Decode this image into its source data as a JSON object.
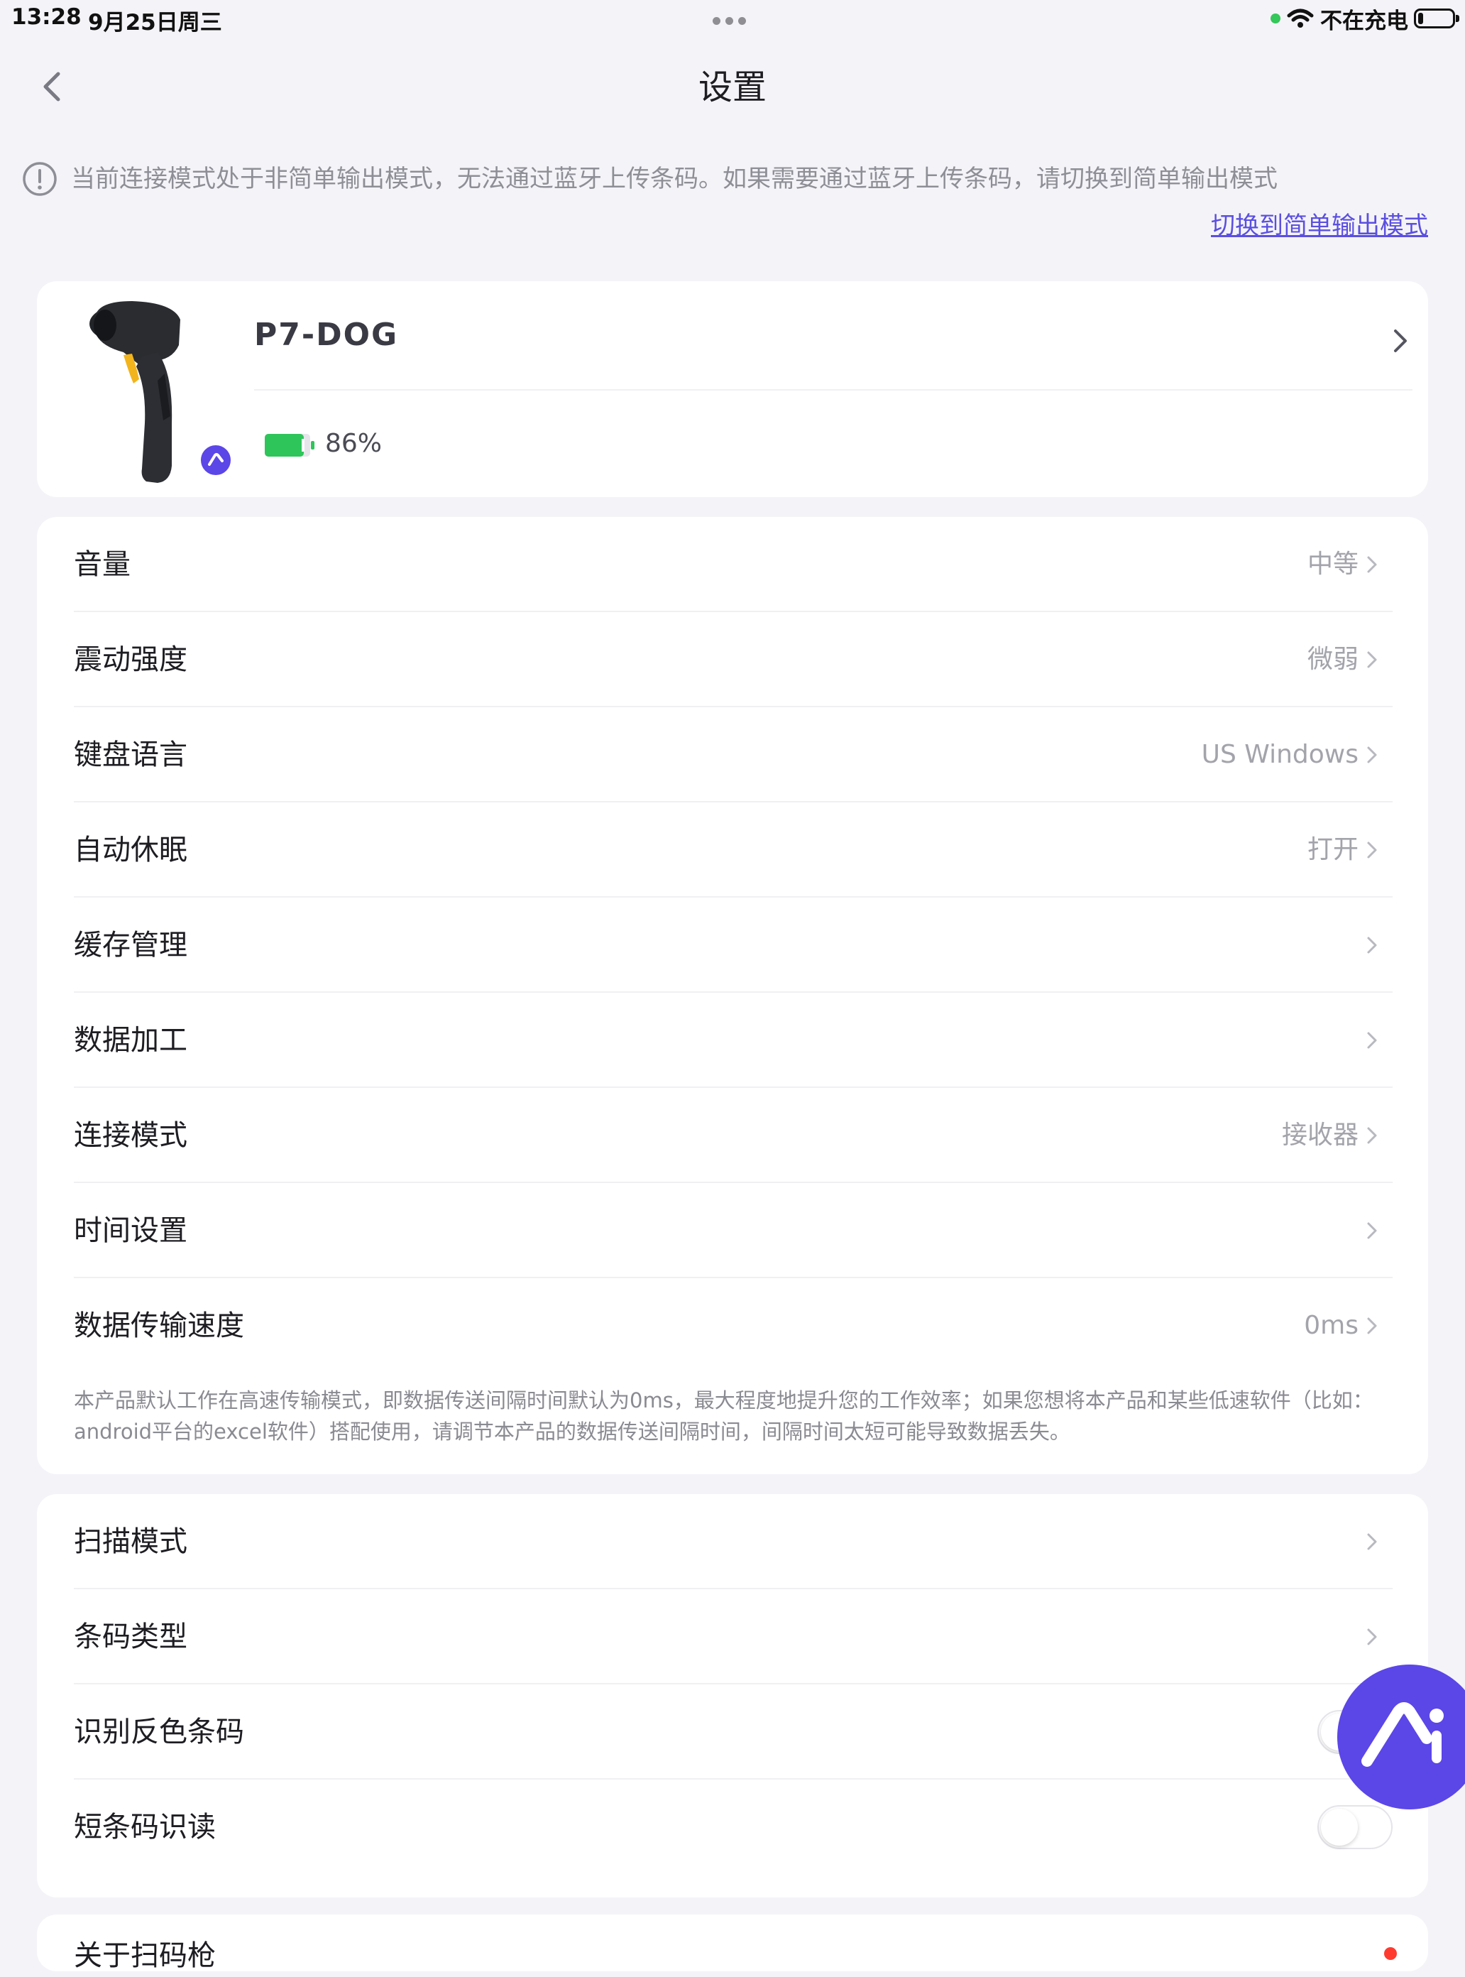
{
  "status_bar": {
    "time": "13:28",
    "date": "9月25日周三",
    "charge_status": "不在充电",
    "battery_level": 0.15
  },
  "header": {
    "title": "设置",
    "back_icon": "chevron-left-icon"
  },
  "notice": {
    "icon": "exclamation-circle-icon",
    "text": "当前连接模式处于非简单输出模式，无法通过蓝牙上传条码。如果需要通过蓝牙上传条码，请切换到简单输出模式",
    "link": "切换到简单输出模式"
  },
  "device": {
    "name": "P7-DOG",
    "battery_percent_text": "86%",
    "battery_level": 0.86,
    "colors": {
      "battery": "#2ec55a",
      "badge": "#5b46e8"
    }
  },
  "settings_group_1": {
    "items": [
      {
        "label": "音量",
        "value": "中等"
      },
      {
        "label": "震动强度",
        "value": "微弱"
      },
      {
        "label": "键盘语言",
        "value": "US Windows"
      },
      {
        "label": "自动休眠",
        "value": "打开"
      },
      {
        "label": "缓存管理",
        "value": ""
      },
      {
        "label": "数据加工",
        "value": ""
      },
      {
        "label": "连接模式",
        "value": "接收器"
      },
      {
        "label": "时间设置",
        "value": ""
      },
      {
        "label": "数据传输速度",
        "value": "0ms"
      }
    ],
    "speed_note": "本产品默认工作在高速传输模式，即数据传送间隔时间默认为0ms，最大程度地提升您的工作效率；如果您想将本产品和某些低速软件（比如：android平台的excel软件）搭配使用，请调节本产品的数据传送间隔时间，间隔时间太短可能导致数据丢失。"
  },
  "settings_group_2": {
    "items": [
      {
        "label": "扫描模式"
      },
      {
        "label": "条码类型"
      },
      {
        "label": "识别反色条码",
        "toggle": false
      },
      {
        "label": "短条码识读",
        "toggle": false
      }
    ]
  },
  "settings_group_3": {
    "label": "关于扫码枪"
  },
  "fab": {
    "icon": "ai-assistant-icon",
    "color": "#5b46e8"
  },
  "colors": {
    "accent": "#5b46e8",
    "link": "#5b4fe0",
    "background": "#f4f4f8"
  }
}
